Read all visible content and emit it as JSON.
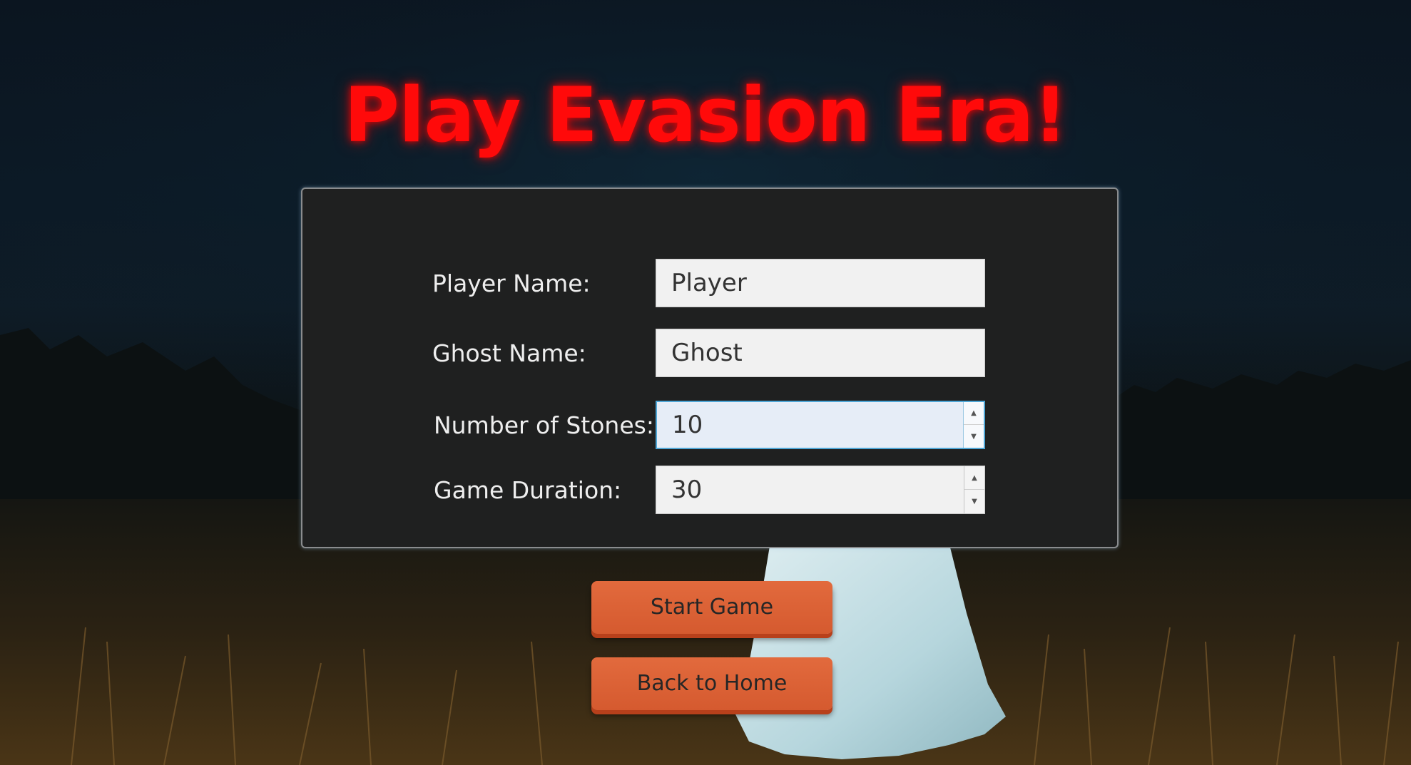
{
  "page": {
    "title": "Play Evasion Era!"
  },
  "form": {
    "player_name": {
      "label": "Player Name:",
      "value": "Player"
    },
    "ghost_name": {
      "label": "Ghost Name:",
      "value": "Ghost"
    },
    "num_stones": {
      "label": "Number of Stones:",
      "value": "10"
    },
    "game_duration": {
      "label": "Game Duration:",
      "value": "30"
    }
  },
  "buttons": {
    "start_label": "Start Game",
    "home_label": "Back to Home"
  },
  "icons": {
    "spinner_up": "caret-up-icon",
    "spinner_down": "caret-down-icon"
  },
  "colors": {
    "title": "#ff0a0a",
    "panel_bg": "#1f2020",
    "button_bg": "#d9603a",
    "focus_border": "#4ea6d6"
  }
}
